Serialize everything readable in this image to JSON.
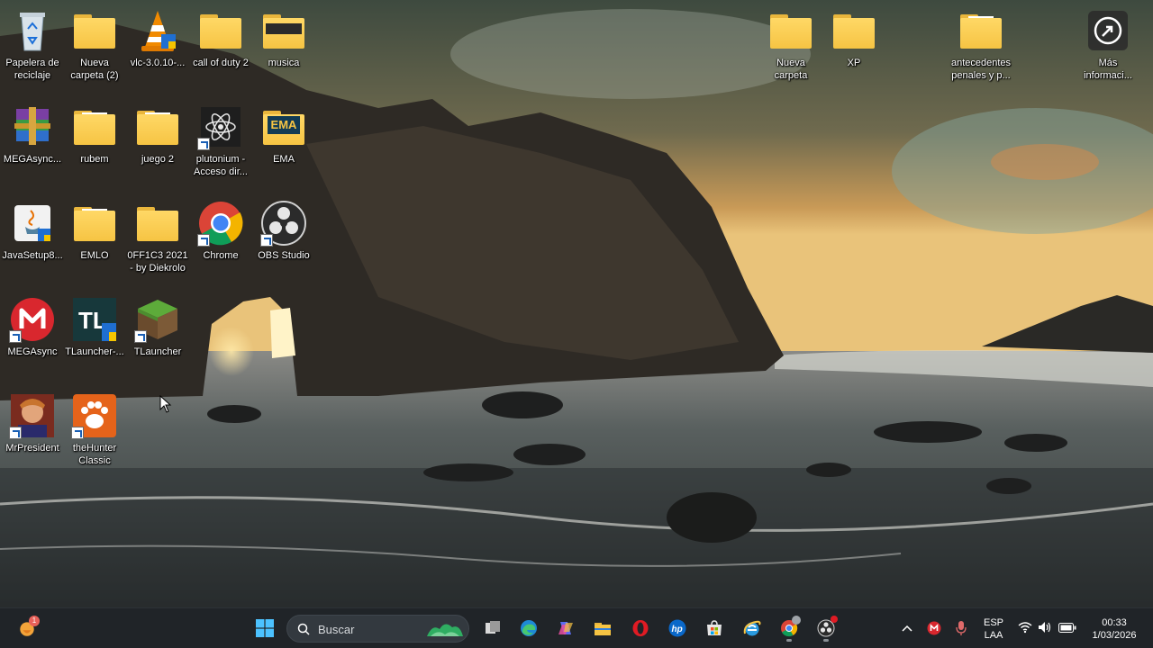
{
  "desktop": {
    "icons": [
      {
        "label": "Papelera de reciclaje",
        "icon": "recycle-bin-icon"
      },
      {
        "label": "Nueva carpeta (2)",
        "icon": "folder-icon"
      },
      {
        "label": "vlc-3.0.10-...",
        "icon": "vlc-cone-icon"
      },
      {
        "label": "call of duty 2",
        "icon": "folder-icon"
      },
      {
        "label": "musica",
        "icon": "folder-icon"
      },
      {
        "label": "MEGAsync...",
        "icon": "winrar-icon"
      },
      {
        "label": "rubem",
        "icon": "folder-icon"
      },
      {
        "label": "juego 2",
        "icon": "folder-icon"
      },
      {
        "label": "plutonium - Acceso dir...",
        "icon": "plutonium-atom-icon"
      },
      {
        "label": "EMA",
        "icon": "folder-icon"
      },
      {
        "label": "JavaSetup8...",
        "icon": "java-setup-icon"
      },
      {
        "label": "EMLO",
        "icon": "folder-icon"
      },
      {
        "label": "0FF1C3 2021 - by Diekrolo",
        "icon": "folder-icon"
      },
      {
        "label": "Chrome",
        "icon": "chrome-icon"
      },
      {
        "label": "OBS Studio",
        "icon": "obs-icon"
      },
      {
        "label": "MEGAsync",
        "icon": "mega-icon"
      },
      {
        "label": "TLauncher-...",
        "icon": "tlauncher-icon"
      },
      {
        "label": "TLauncher",
        "icon": "minecraft-grass-block-icon"
      },
      {
        "label": "MrPresident",
        "icon": "mrpresident-game-icon"
      },
      {
        "label": "theHunter Classic",
        "icon": "thehunter-paw-icon"
      },
      {
        "label": "Nueva carpeta",
        "icon": "folder-icon"
      },
      {
        "label": "XP",
        "icon": "folder-icon"
      },
      {
        "label": "antecedentes penales y p...",
        "icon": "folder-icon"
      },
      {
        "label": "Más informaci...",
        "icon": "info-circle-icon"
      }
    ]
  },
  "taskbar": {
    "search_placeholder": "Buscar",
    "widget_badge": "1",
    "pinned": [
      {
        "name": "start-button",
        "icon": "windows-logo-icon"
      },
      {
        "name": "task-view-button",
        "icon": "task-view-icon"
      },
      {
        "name": "edge-button",
        "icon": "edge-icon"
      },
      {
        "name": "copilot-button",
        "icon": "copilot-icon"
      },
      {
        "name": "file-explorer-button",
        "icon": "folder-icon"
      },
      {
        "name": "opera-button",
        "icon": "opera-icon"
      },
      {
        "name": "hp-button",
        "icon": "hp-icon"
      },
      {
        "name": "store-button",
        "icon": "microsoft-store-icon"
      },
      {
        "name": "internet-explorer-button",
        "icon": "internet-explorer-icon"
      },
      {
        "name": "chrome-button",
        "icon": "chrome-icon"
      },
      {
        "name": "obs-button",
        "icon": "obs-icon"
      }
    ],
    "tray": {
      "language_line1": "ESP",
      "language_line2": "LAA",
      "time": "00:33",
      "date": "1/03/2026"
    }
  },
  "colors": {
    "taskbar_bg": "#202428",
    "folder_yellow": "#f6c443",
    "accent_blue": "#0078d4"
  }
}
